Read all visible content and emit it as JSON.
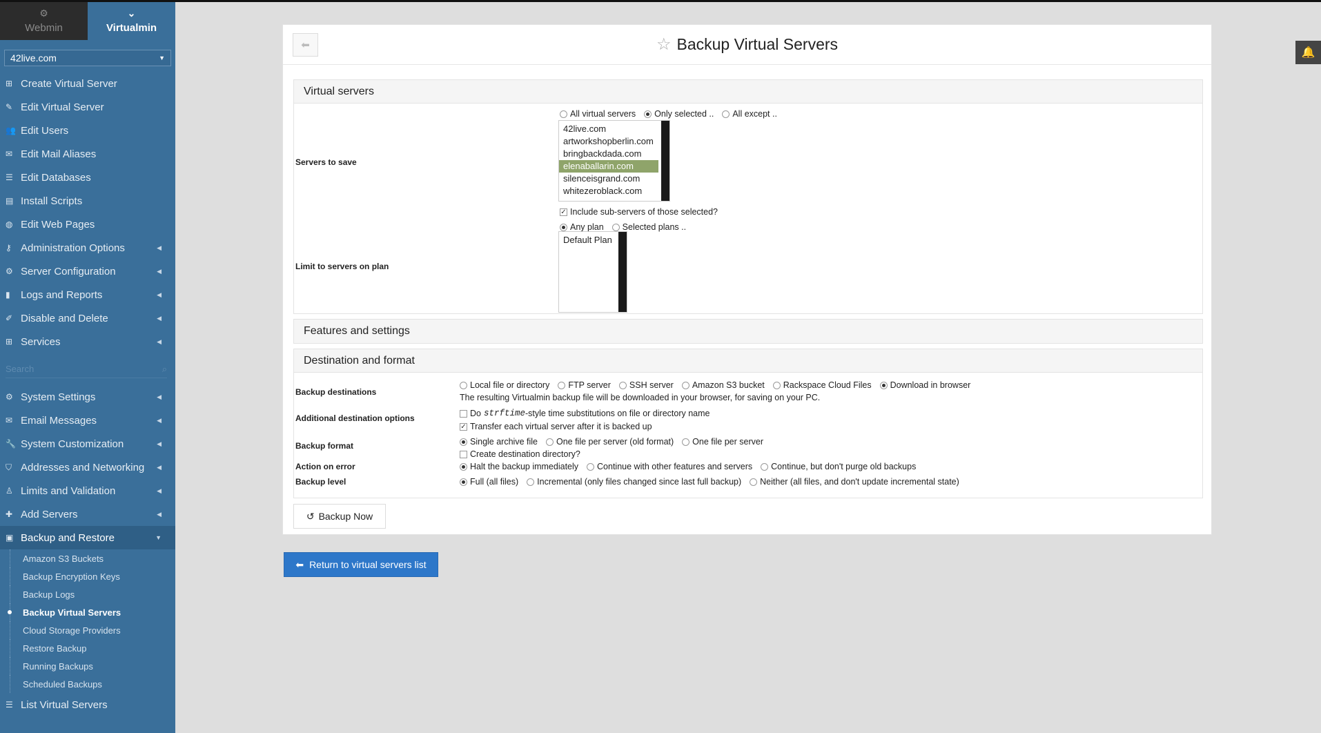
{
  "tabs": {
    "webmin": "Webmin",
    "virtualmin": "Virtualmin"
  },
  "domain_select": "42live.com",
  "nav": [
    {
      "label": "Create Virtual Server",
      "icon": "plus-square-icon",
      "arrow": false
    },
    {
      "label": "Edit Virtual Server",
      "icon": "edit-icon",
      "arrow": false
    },
    {
      "label": "Edit Users",
      "icon": "users-icon",
      "arrow": false
    },
    {
      "label": "Edit Mail Aliases",
      "icon": "envelope-icon",
      "arrow": false
    },
    {
      "label": "Edit Databases",
      "icon": "database-icon",
      "arrow": false
    },
    {
      "label": "Install Scripts",
      "icon": "install-icon",
      "arrow": false
    },
    {
      "label": "Edit Web Pages",
      "icon": "globe-icon",
      "arrow": false
    },
    {
      "label": "Administration Options",
      "icon": "key-icon",
      "arrow": true
    },
    {
      "label": "Server Configuration",
      "icon": "cogs-icon",
      "arrow": true
    },
    {
      "label": "Logs and Reports",
      "icon": "file-icon",
      "arrow": true
    },
    {
      "label": "Disable and Delete",
      "icon": "brush-icon",
      "arrow": true
    },
    {
      "label": "Services",
      "icon": "sitemap-icon",
      "arrow": true
    }
  ],
  "search_placeholder": "Search",
  "nav2": [
    {
      "label": "System Settings",
      "icon": "gear-icon",
      "arrow": true
    },
    {
      "label": "Email Messages",
      "icon": "envelope-icon",
      "arrow": true
    },
    {
      "label": "System Customization",
      "icon": "wrench-icon",
      "arrow": true
    },
    {
      "label": "Addresses and Networking",
      "icon": "shield-icon",
      "arrow": true
    },
    {
      "label": "Limits and Validation",
      "icon": "user-lock-icon",
      "arrow": true
    },
    {
      "label": "Add Servers",
      "icon": "plus-icon",
      "arrow": true
    },
    {
      "label": "Backup and Restore",
      "icon": "save-icon",
      "arrow": true
    }
  ],
  "subnav": [
    "Amazon S3 Buckets",
    "Backup Encryption Keys",
    "Backup Logs",
    "Backup Virtual Servers",
    "Cloud Storage Providers",
    "Restore Backup",
    "Running Backups",
    "Scheduled Backups"
  ],
  "nav_last": "List Virtual Servers",
  "page_title": "Backup Virtual Servers",
  "sections": {
    "virtual_servers": "Virtual servers",
    "features": "Features and settings",
    "destination": "Destination and format"
  },
  "servers_to_save": {
    "label": "Servers to save",
    "options": [
      "All virtual servers",
      "Only selected ..",
      "All except .."
    ],
    "selected_option": 1,
    "list": [
      "42live.com",
      "artworkshopberlin.com",
      "bringbackdada.com",
      "elenaballarin.com",
      "silenceisgrand.com",
      "whitezeroblack.com"
    ],
    "selected_item": 3,
    "include_sub": "Include sub-servers of those selected?",
    "plan_options": [
      "Any plan",
      "Selected plans .."
    ]
  },
  "limit_plan": {
    "label": "Limit to servers on plan",
    "list": [
      "Default Plan"
    ]
  },
  "backup_destinations": {
    "label": "Backup destinations",
    "options": [
      "Local file or directory",
      "FTP server",
      "SSH server",
      "Amazon S3 bucket",
      "Rackspace Cloud Files",
      "Download in browser"
    ],
    "selected": 5,
    "note": "The resulting Virtualmin backup file will be downloaded in your browser, for saving on your PC."
  },
  "additional_options": {
    "label": "Additional destination options",
    "strftime_pre": "Do",
    "strftime_code": "strftime",
    "strftime_post": "-style time substitutions on file or directory name",
    "transfer": "Transfer each virtual server after it is backed up"
  },
  "backup_format": {
    "label": "Backup format",
    "options": [
      "Single archive file",
      "One file per server (old format)",
      "One file per server"
    ],
    "create_dir": "Create destination directory?"
  },
  "action_on_error": {
    "label": "Action on error",
    "options": [
      "Halt the backup immediately",
      "Continue with other features and servers",
      "Continue, but don't purge old backups"
    ]
  },
  "backup_level": {
    "label": "Backup level",
    "options": [
      "Full (all files)",
      "Incremental (only files changed since last full backup)",
      "Neither (all files, and don't update incremental state)"
    ]
  },
  "buttons": {
    "backup_now": "Backup Now",
    "return": "Return to virtual servers list"
  }
}
